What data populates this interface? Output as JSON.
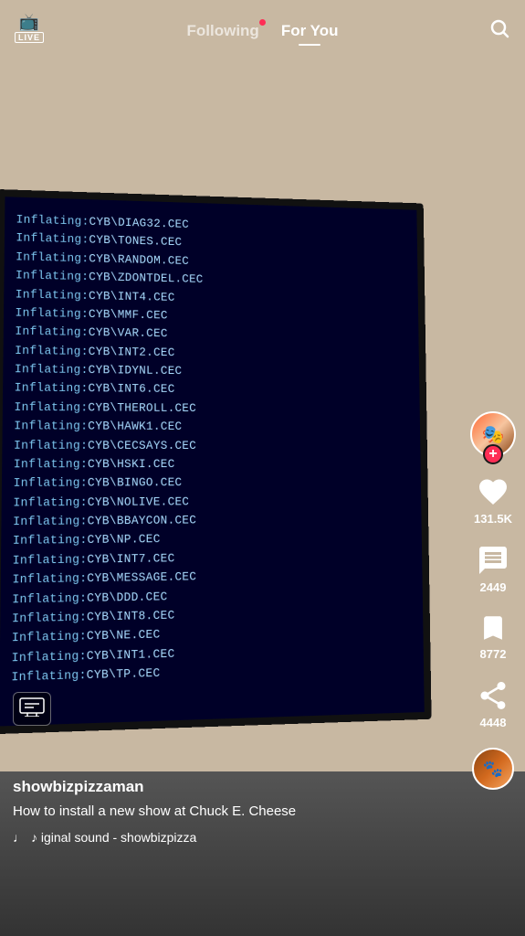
{
  "header": {
    "live_label": "LIVE",
    "following_label": "Following",
    "for_you_label": "For You",
    "active_tab": "for_you",
    "has_notification": true
  },
  "video": {
    "background_color": "#c8b8a2"
  },
  "monitor": {
    "lines": [
      {
        "prefix": "Inflating: ",
        "path": "CYB\\DIAG32.CEC"
      },
      {
        "prefix": "Inflating: ",
        "path": "CYB\\TONES.CEC"
      },
      {
        "prefix": "Inflating: ",
        "path": "CYB\\RANDOM.CEC"
      },
      {
        "prefix": "Inflating: ",
        "path": "CYB\\ZDONTDEL.CEC"
      },
      {
        "prefix": "Inflating: ",
        "path": "CYB\\INT4.CEC"
      },
      {
        "prefix": "Inflating: ",
        "path": "CYB\\MMF.CEC"
      },
      {
        "prefix": "Inflating: ",
        "path": "CYB\\VAR.CEC"
      },
      {
        "prefix": "Inflating: ",
        "path": "CYB\\INT2.CEC"
      },
      {
        "prefix": "Inflating: ",
        "path": "CYB\\IDYNL.CEC"
      },
      {
        "prefix": "Inflating: ",
        "path": "CYB\\INT6.CEC"
      },
      {
        "prefix": "Inflating: ",
        "path": "CYB\\THEROLL.CEC"
      },
      {
        "prefix": "Inflating: ",
        "path": "CYB\\HAWK1.CEC"
      },
      {
        "prefix": "Inflating: ",
        "path": "CYB\\CECSAYS.CEC"
      },
      {
        "prefix": "Inflating: ",
        "path": "CYB\\HSKI.CEC"
      },
      {
        "prefix": "Inflating: ",
        "path": "CYB\\BINGO.CEC"
      },
      {
        "prefix": "Inflating: ",
        "path": "CYB\\NOLIVE.CEC"
      },
      {
        "prefix": "Inflating: ",
        "path": "CYB\\BBAYCON.CEC"
      },
      {
        "prefix": "Inflating: ",
        "path": "CYB\\NP.CEC"
      },
      {
        "prefix": "Inflating: ",
        "path": "CYB\\INT7.CEC"
      },
      {
        "prefix": "Inflating: ",
        "path": "CYB\\MESSAGE.CEC"
      },
      {
        "prefix": "Inflating: ",
        "path": "CYB\\DDD.CEC"
      },
      {
        "prefix": "Inflating: ",
        "path": "CYB\\INT8.CEC"
      },
      {
        "prefix": "Inflating: ",
        "path": "CYB\\NE.CEC"
      },
      {
        "prefix": "Inflating: ",
        "path": "CYB\\INT1.CEC"
      },
      {
        "prefix": "Inflating: ",
        "path": "CYB\\TP.CEC"
      }
    ]
  },
  "sidebar": {
    "avatar_emoji": "🎭",
    "bottom_avatar_emoji": "🐾",
    "like_count": "131.5K",
    "comment_count": "2449",
    "bookmark_count": "8772",
    "share_count": "4448"
  },
  "post": {
    "username": "showbizpizzaman",
    "description": "How to install a new show at Chuck E. Cheese",
    "sound_text": "♪ iginal sound - showbizpizza"
  },
  "icons": {
    "search": "🔍",
    "music_note": "♩",
    "heart": "♡",
    "comment": "💬",
    "bookmark": "🔖",
    "share": "↗"
  }
}
